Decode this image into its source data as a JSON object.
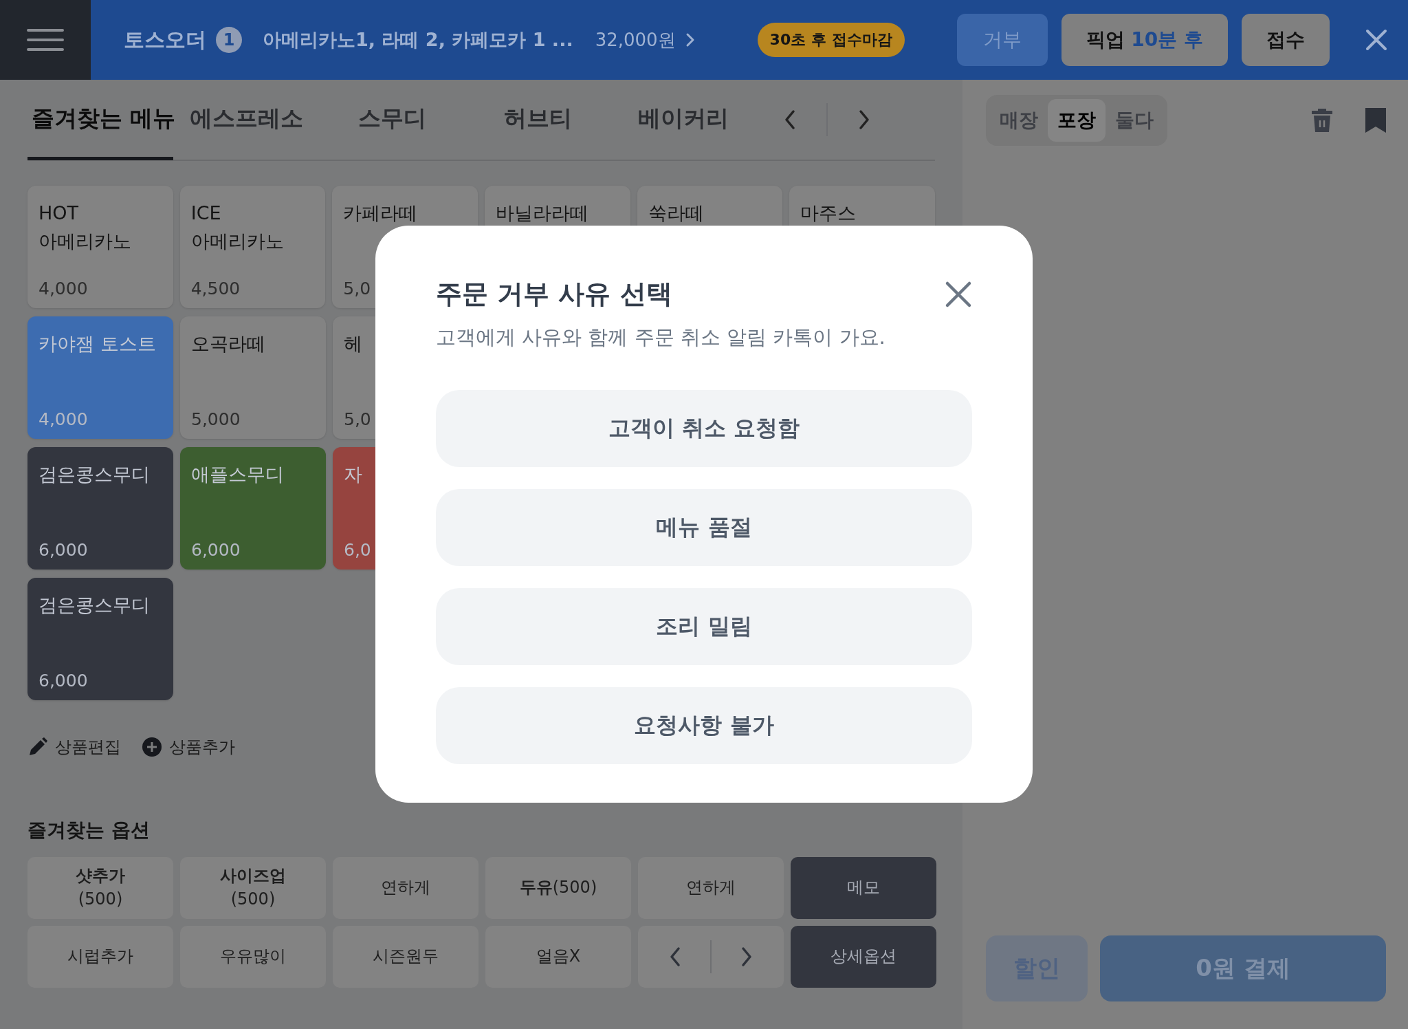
{
  "top_bar": {
    "brand": "토스오더",
    "order_count": "1",
    "summary": "아메리카노1, 라떼 2, 카페모카 1 ...",
    "total": "32,000원",
    "deadline": "30초 후 접수마감",
    "buttons": [
      {
        "kind": "reject",
        "label": "거부"
      },
      {
        "kind": "pickup",
        "label": "픽업",
        "time": "10분 후"
      },
      {
        "kind": "accept",
        "label": "접수"
      }
    ]
  },
  "tabs": [
    {
      "label": "즐겨찾는 메뉴",
      "selected": true
    },
    {
      "label": "에스프레소",
      "selected": false
    },
    {
      "label": "스무디",
      "selected": false
    },
    {
      "label": "허브티",
      "selected": false
    },
    {
      "label": "베이커리",
      "selected": false
    }
  ],
  "menu_rows": [
    [
      {
        "name": "HOT\n아메리카노",
        "price": "4,000",
        "color": "#838383"
      },
      {
        "name": "ICE\n아메리카노",
        "price": "4,500",
        "color": "#838383"
      },
      {
        "name": "카페라떼",
        "price": "5,0",
        "color": "#838383"
      },
      {
        "name": "바닐라라떼",
        "color": "#838383"
      },
      {
        "name": "쑥라떼",
        "color": "#838383"
      },
      {
        "name": "마주스",
        "color": "#838383"
      }
    ],
    [
      {
        "name": "카야잼 토스트",
        "price": "4,000",
        "color": "#3d6cb0"
      },
      {
        "name": "오곡라떼",
        "price": "5,000",
        "color": "#838383"
      },
      {
        "name": "헤",
        "price": "5,0",
        "color": "#838383"
      }
    ],
    [
      {
        "name": "검은콩스무디",
        "price": "6,000",
        "color": "#33363f"
      },
      {
        "name": "애플스무디",
        "price": "6,000",
        "color": "#3d5e30"
      },
      {
        "name": "자",
        "price": "6,0",
        "color": "#96443f"
      }
    ],
    [
      {
        "name": "검은콩스무디",
        "price": "6,000",
        "color": "#33363f"
      }
    ]
  ],
  "menu_actions": [
    {
      "kind": "edit",
      "label": "상품편집"
    },
    {
      "kind": "add",
      "label": "상품추가"
    }
  ],
  "options": {
    "title": "즐겨찾는 옵션",
    "items": [
      {
        "kind": "option",
        "name": "샷추가",
        "price": "(500)",
        "price_below": true
      },
      {
        "kind": "option",
        "name": "사이즈업",
        "price": "(500)",
        "price_below": true
      },
      {
        "kind": "option",
        "name": "연하게"
      },
      {
        "kind": "option",
        "name": "두유",
        "price": "(500)",
        "price_below": false
      },
      {
        "kind": "option",
        "name": "연하게"
      },
      {
        "kind": "action",
        "name": "메모"
      },
      {
        "kind": "option",
        "name": "시럽추가"
      },
      {
        "kind": "option",
        "name": "우유많이"
      },
      {
        "kind": "option",
        "name": "시즌원두"
      },
      {
        "kind": "option",
        "name": "얼음X"
      },
      {
        "kind": "nav"
      },
      {
        "kind": "action",
        "name": "상세옵션"
      }
    ]
  },
  "order_panel": {
    "modes": [
      {
        "label": "매장",
        "selected": false
      },
      {
        "label": "포장",
        "selected": true
      },
      {
        "label": "둘다",
        "selected": false
      }
    ],
    "discount": {
      "label": "할인",
      "disabled": true
    },
    "pay": {
      "label": "0원 결제",
      "disabled": true
    }
  },
  "dialog": {
    "title": "주문 거부 사유 선택",
    "subtitle": "고객에게 사유와 함께 주문 취소 알림 카톡이 가요.",
    "reasons": [
      "고객이 취소 요청함",
      "메뉴 품절",
      "조리 밀림",
      "요청사항 불가"
    ]
  }
}
